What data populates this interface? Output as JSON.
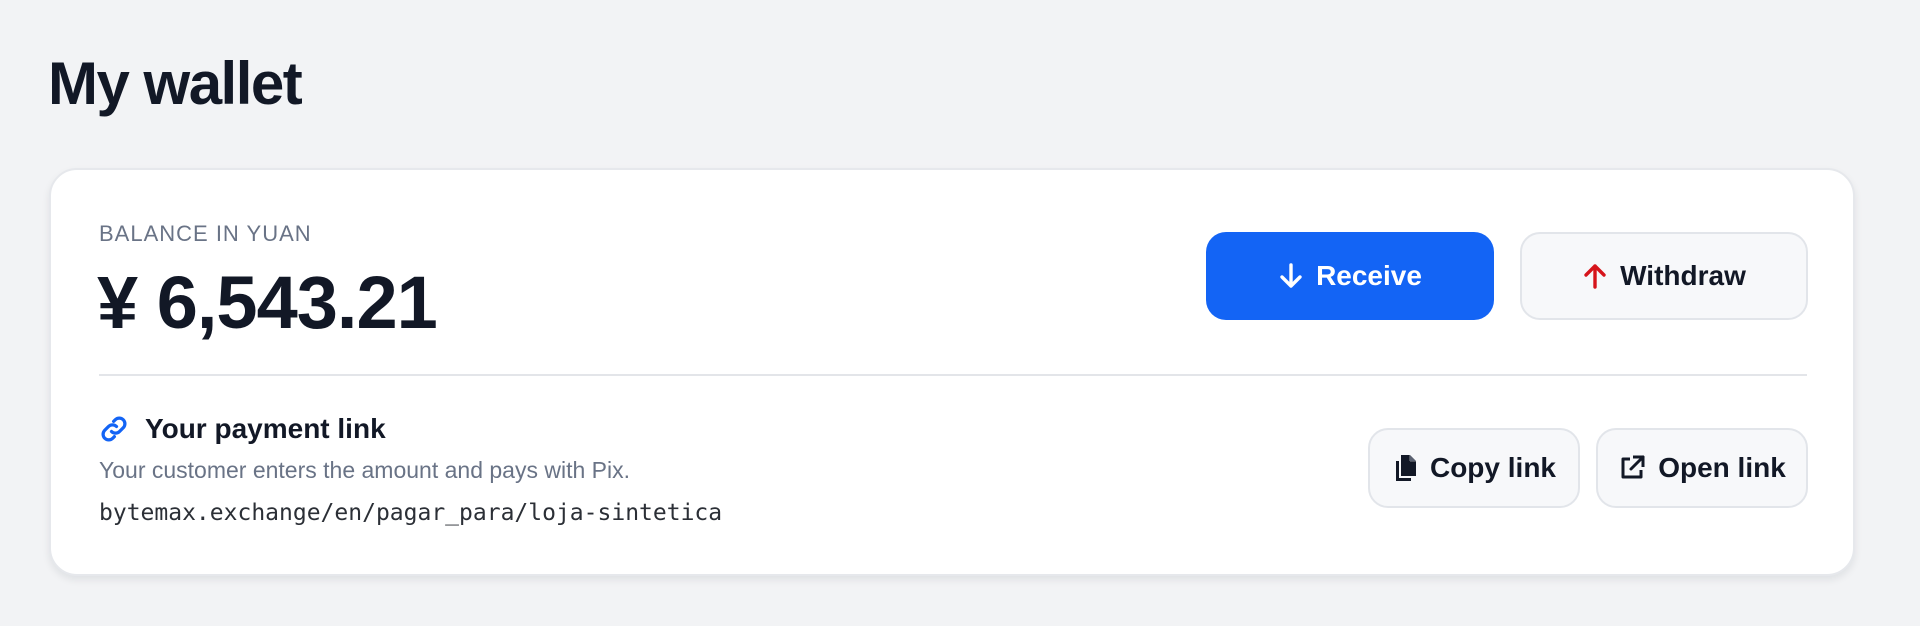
{
  "page": {
    "title": "My wallet"
  },
  "balance": {
    "label": "BALANCE IN YUAN",
    "amount": "¥ 6,543.21"
  },
  "actions": {
    "receive_label": "Receive",
    "receive_icon": "arrow-down-icon",
    "withdraw_label": "Withdraw",
    "withdraw_icon": "arrow-up-icon"
  },
  "payment_link": {
    "title": "Your payment link",
    "icon": "link-icon",
    "description": "Your customer enters the amount and pays with Pix.",
    "url": "bytemax.exchange/en/pagar_para/loja-sintetica",
    "copy_label": "Copy link",
    "copy_icon": "copy-icon",
    "open_label": "Open link",
    "open_icon": "external-link-icon"
  },
  "colors": {
    "primary": "#1364f5",
    "danger": "#d6141b",
    "background": "#f2f3f5",
    "card": "#ffffff",
    "text": "#121826",
    "muted": "#697386"
  }
}
